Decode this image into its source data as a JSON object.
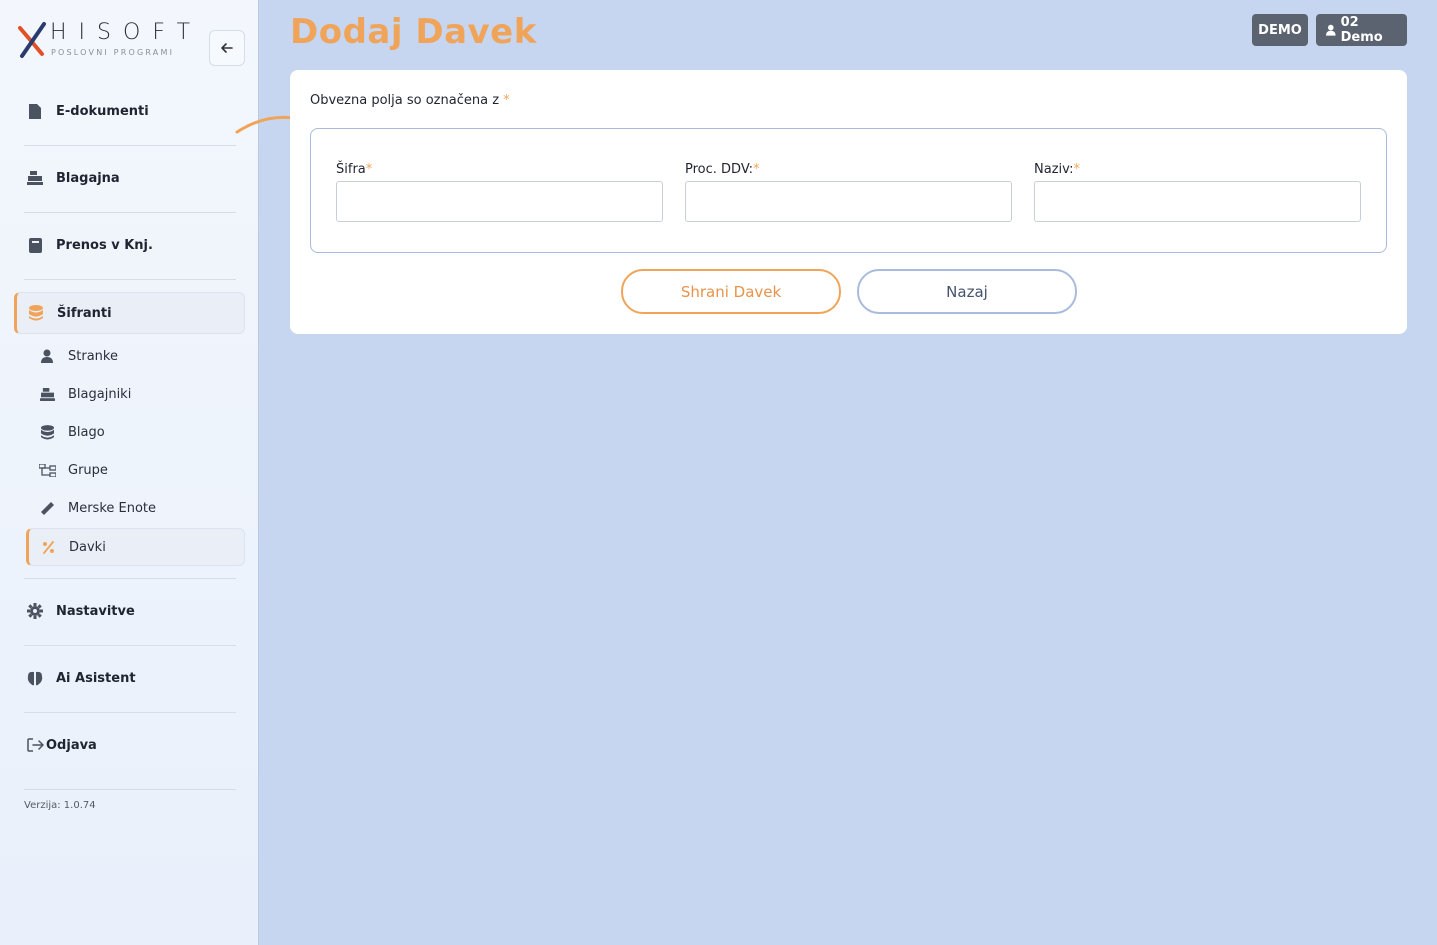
{
  "brand": {
    "name": "HISOFT",
    "tagline": "POSLOVNI PROGRAMI",
    "colors": {
      "accent": "#f0a45a",
      "dark": "#5b6370",
      "navy": "#2a3b6e",
      "red": "#e0512a"
    }
  },
  "sidebar": {
    "collapse_icon": "arrow-left-icon",
    "items": [
      {
        "label": "E-dokumenti",
        "icon": "file-icon"
      },
      {
        "label": "Blagajna",
        "icon": "cash-register-icon"
      },
      {
        "label": "Prenos v Knj.",
        "icon": "book-icon"
      },
      {
        "label": "Šifranti",
        "icon": "database-icon",
        "active": true
      }
    ],
    "sub_items": [
      {
        "label": "Stranke",
        "icon": "user-icon"
      },
      {
        "label": "Blagajniki",
        "icon": "cash-register-icon"
      },
      {
        "label": "Blago",
        "icon": "database-icon"
      },
      {
        "label": "Grupe",
        "icon": "sitemap-icon"
      },
      {
        "label": "Merske Enote",
        "icon": "ruler-icon"
      },
      {
        "label": "Davki",
        "icon": "percent-icon",
        "active": true
      }
    ],
    "bottom_items": [
      {
        "label": "Nastavitve",
        "icon": "gear-icon"
      },
      {
        "label": "Ai Asistent",
        "icon": "brain-icon"
      },
      {
        "label": "Odjava",
        "icon": "logout-icon"
      }
    ],
    "version": "Verzija: 1.0.74"
  },
  "header": {
    "title": "Dodaj Davek",
    "demo_badge": "DEMO",
    "user_label": "02 Demo"
  },
  "form": {
    "required_note": "Obvezna polja so označena z",
    "required_star": "*",
    "fields": [
      {
        "label": "Šifra",
        "value": ""
      },
      {
        "label": "Proc. DDV:",
        "value": ""
      },
      {
        "label": "Naziv:",
        "value": ""
      }
    ],
    "save_label": "Shrani Davek",
    "back_label": "Nazaj"
  }
}
